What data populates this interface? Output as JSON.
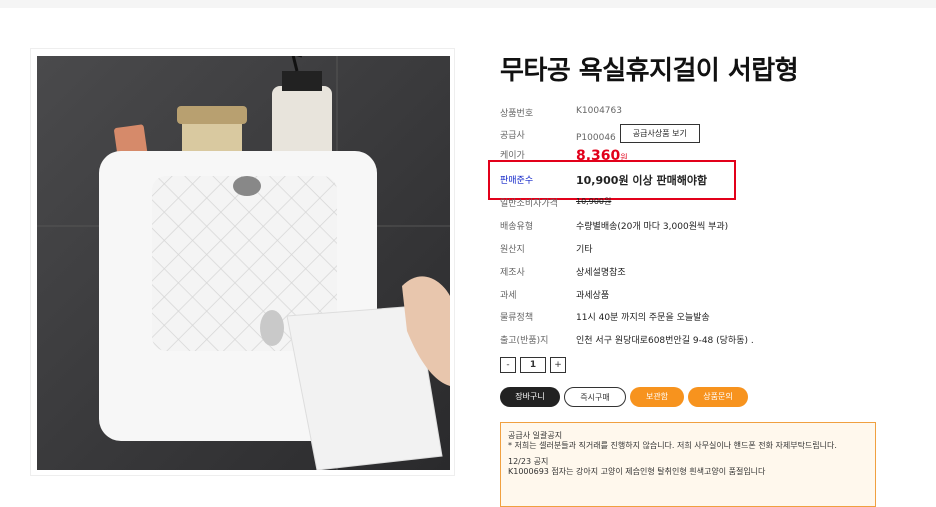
{
  "product": {
    "title": "무타공 욕실휴지걸이 서랍형",
    "rows": {
      "code": {
        "label": "상품번호",
        "value": "K1004763"
      },
      "supplier": {
        "label": "공급사",
        "value": "P100046",
        "button": "공급사상품 보기"
      },
      "cake": {
        "label": "케이가",
        "value": "8,360",
        "unit": "원"
      },
      "min": {
        "label": "판매준수",
        "value": "10,900원 이상 판매해야함"
      },
      "consumer": {
        "label": "일반소비자가격",
        "value": "10,900원"
      },
      "shipping": {
        "label": "배송유형",
        "value": "수량별배송(20개 마다 3,000원씩 부과)"
      },
      "origin": {
        "label": "원산지",
        "value": "기타"
      },
      "maker": {
        "label": "제조사",
        "value": "상세설명참조"
      },
      "tax": {
        "label": "과세",
        "value": "과세상품"
      },
      "logistics": {
        "label": "물류정책",
        "value": "11시 40분 까지의 주문을 오늘발송"
      },
      "ship_from": {
        "label": "출고(반품)지",
        "value": "인천 서구 원당대로608번안길 9-48 (당하동) ."
      }
    }
  },
  "quantity": {
    "minus": "-",
    "value": "1",
    "plus": "+"
  },
  "actions": {
    "cart": "장바구니",
    "buy": "즉시구매",
    "save": "보관함",
    "inquiry": "상품문의"
  },
  "notice": {
    "heading": "공급사 일괄공지",
    "line1": "* 저희는 셀러분들과 직거래를 진행하지 않습니다. 저희 사무실이나 핸드폰 전화 자제부탁드립니다.",
    "date": "12/23 공지",
    "line2": "K1000693 점자는 강아지 고양이 제습인형 탈취인형 흰색고양이 품절입니다"
  },
  "colors": {
    "accent_red": "#e2001a",
    "accent_blue": "#1226c9",
    "orange": "#f7931e",
    "dark": "#222222"
  }
}
